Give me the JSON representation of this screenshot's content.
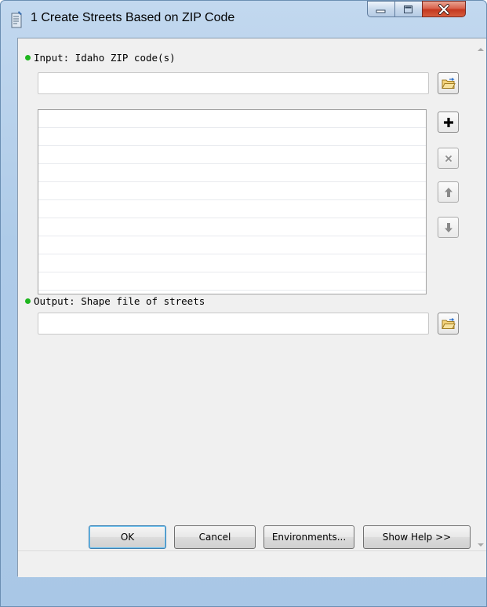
{
  "window": {
    "title": "1 Create Streets Based on ZIP Code",
    "icon": "script-tool-icon",
    "controls": [
      "minimize-icon",
      "maximize-icon",
      "close-icon"
    ]
  },
  "parameters": [
    {
      "label": "Input: Idaho ZIP code(s)",
      "value": "",
      "required_color": "#1fb61f"
    },
    {
      "label": "Output: Shape file of streets",
      "value": "",
      "required_color": "#1fb61f"
    }
  ],
  "value_list": {
    "items": [],
    "actions": [
      "add-icon",
      "remove-icon",
      "move-up-icon",
      "move-down-icon"
    ]
  },
  "buttons": {
    "ok": "OK",
    "cancel": "Cancel",
    "environments": "Environments...",
    "show_help": "Show Help >>"
  },
  "colors": {
    "frame": "#aecbe8",
    "dialog_bg": "#f0f0f0",
    "close_button": "#c4381f",
    "default_button_border": "#3c7fb1"
  }
}
